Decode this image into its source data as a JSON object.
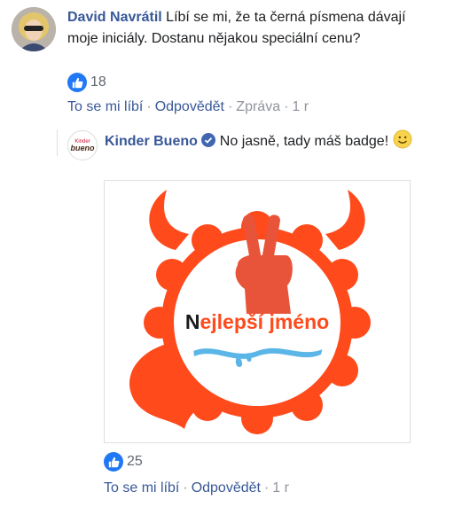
{
  "comment": {
    "author": "David Navrátil",
    "text": "Líbí se mi, že ta černá písmena dávají moje iniciály. Dostanu nějakou speciální cenu?",
    "reaction_count": "18",
    "actions": {
      "like": "To se mi líbí",
      "reply": "Odpovědět",
      "message": "Zpráva",
      "time": "1 r"
    }
  },
  "reply": {
    "author": "Kinder Bueno",
    "text": "No jasně, tady máš badge!",
    "avatar_text_top": "Kinder",
    "avatar_text_bottom": "bueno",
    "image": {
      "badge_text_first_letter": "N",
      "badge_text_rest": "ejlepší jméno"
    },
    "reaction_count": "25",
    "actions": {
      "like": "To se mi líbí",
      "reply": "Odpovědět",
      "time": "1 r"
    }
  },
  "colors": {
    "link": "#385898",
    "like_blue": "#2078f4",
    "badge_orange": "#ff4a1c",
    "meta_gray": "#90949c"
  },
  "icons": [
    "like-icon",
    "verified-icon",
    "smile-emoji-icon",
    "peace-hand-icon"
  ]
}
